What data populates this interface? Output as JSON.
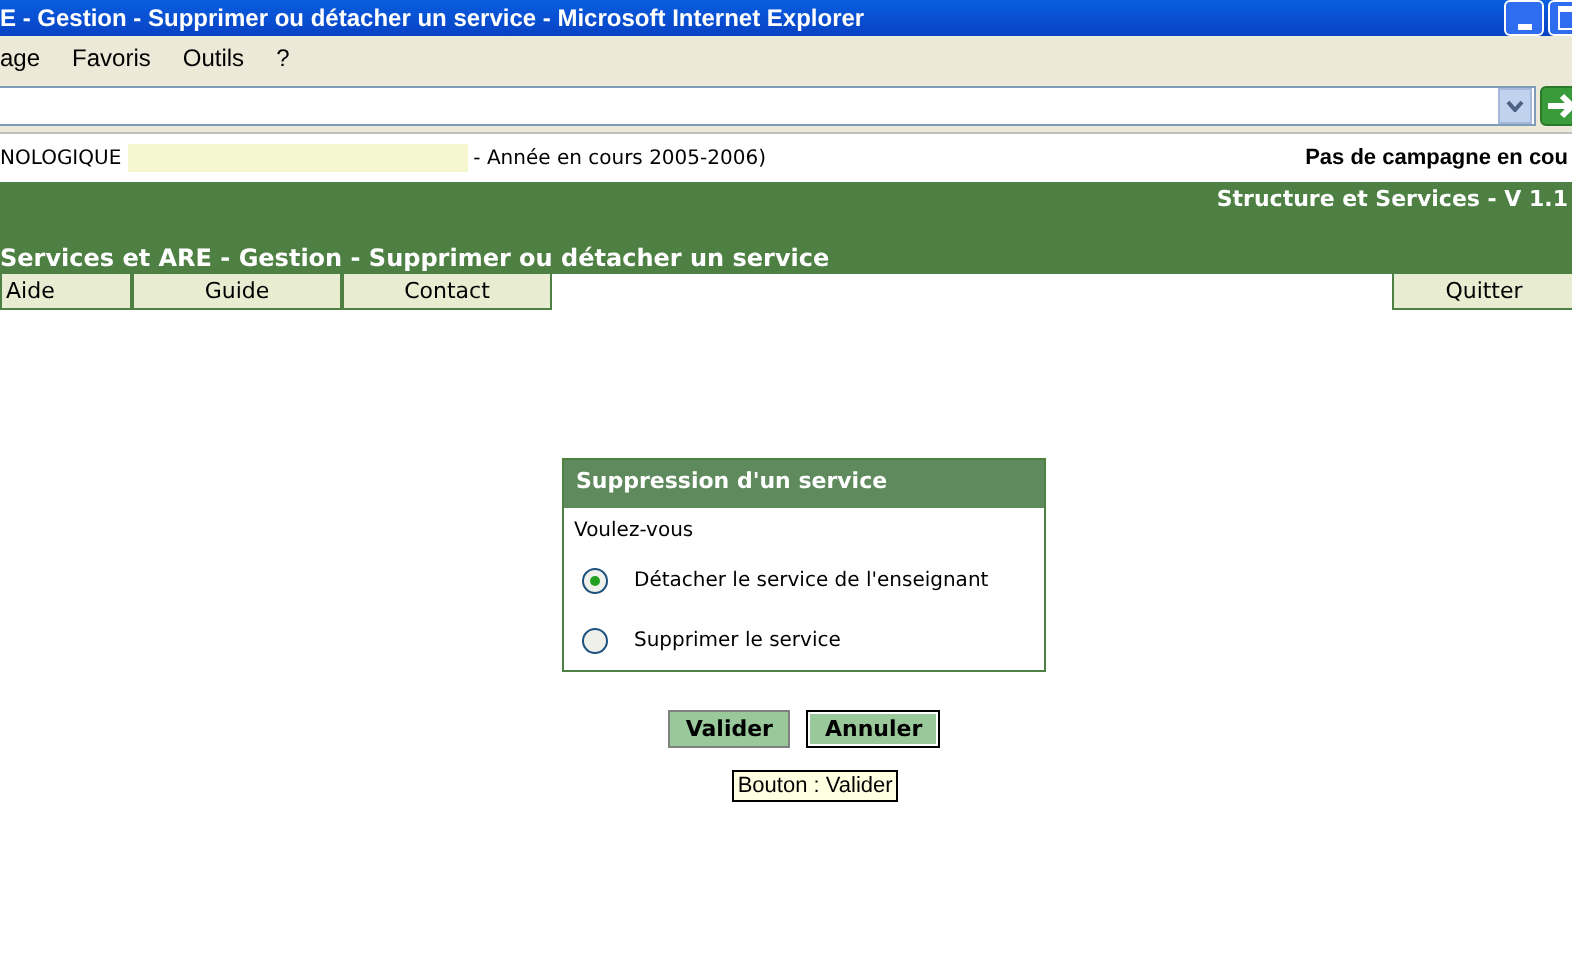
{
  "window": {
    "title": "E - Gestion - Supprimer ou détacher un service - Microsoft Internet Explorer"
  },
  "menu": [
    "age",
    "Favoris",
    "Outils",
    "?"
  ],
  "info_line": {
    "prefix": "NOLOGIQUE",
    "year": "- Année en cours 2005-2006)",
    "campaign": "Pas de campagne en cou"
  },
  "header": {
    "app": "Structure et Services - V 1.1",
    "page_title": "Services et ARE - Gestion - Supprimer ou détacher un service"
  },
  "nav_left": [
    "Aide",
    "Guide",
    "Contact"
  ],
  "nav_right": [
    "Quitter"
  ],
  "dialog": {
    "title": "Suppression d'un service",
    "question": "Voulez-vous",
    "options": [
      {
        "label": "Détacher le service de l'enseignant",
        "selected": true
      },
      {
        "label": "Supprimer le service",
        "selected": false
      }
    ]
  },
  "buttons": [
    {
      "label": "Valider",
      "focused": false
    },
    {
      "label": "Annuler",
      "focused": true
    }
  ],
  "tooltip": "Bouton : Valider"
}
